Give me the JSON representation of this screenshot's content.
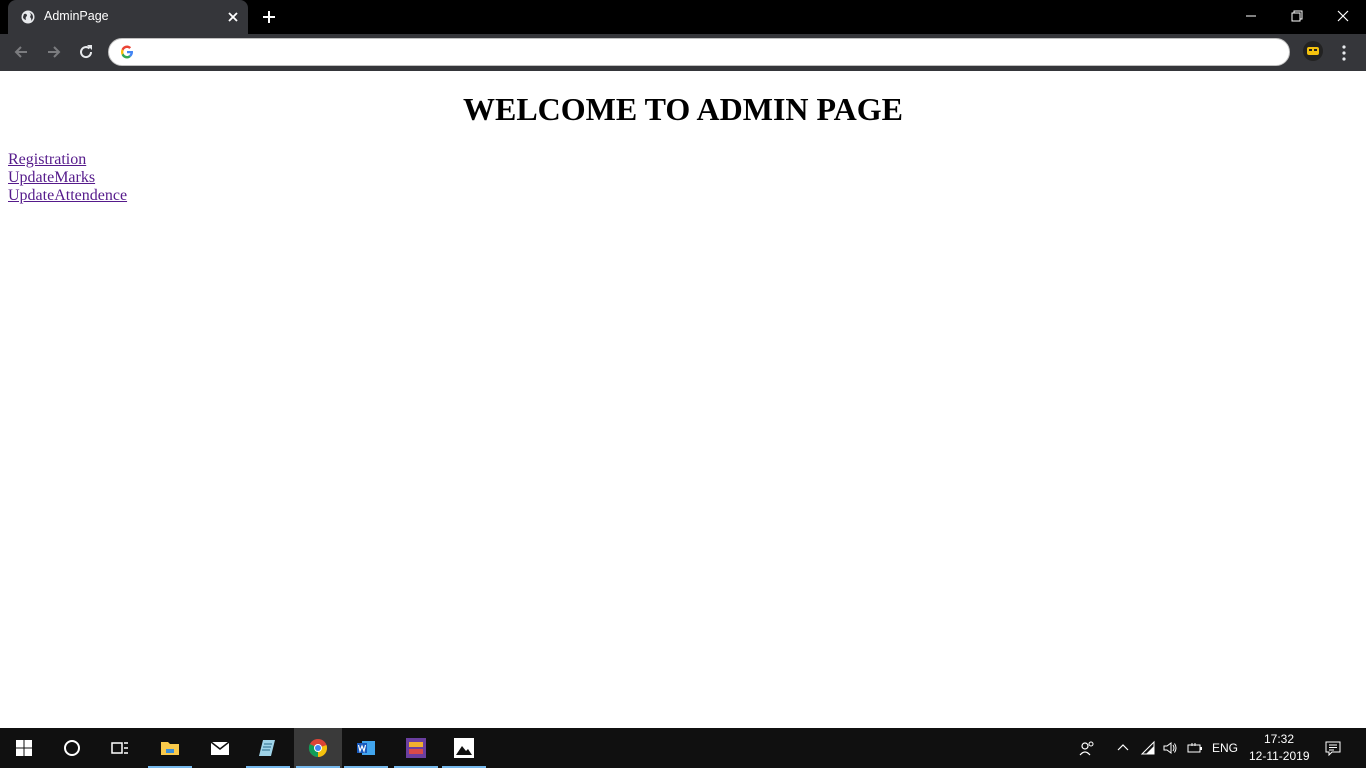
{
  "browser": {
    "tab_title": "AdminPage",
    "address_value": "",
    "colors": {
      "chrome_dark": "#35363a",
      "titlebar": "#000000",
      "link_visited": "#551a8b"
    }
  },
  "page": {
    "heading": "WELCOME TO ADMIN PAGE",
    "links": [
      {
        "label": "Registration"
      },
      {
        "label": "UpdateMarks"
      },
      {
        "label": "UpdateAttendence"
      }
    ]
  },
  "taskbar": {
    "apps": [
      "start-icon",
      "cortana-icon",
      "task-view-icon",
      "file-explorer-icon",
      "mail-icon",
      "notepad-icon",
      "chrome-icon",
      "word-icon",
      "app-icon",
      "photos-icon"
    ],
    "language": "ENG",
    "time": "17:32",
    "date": "12-11-2019"
  }
}
